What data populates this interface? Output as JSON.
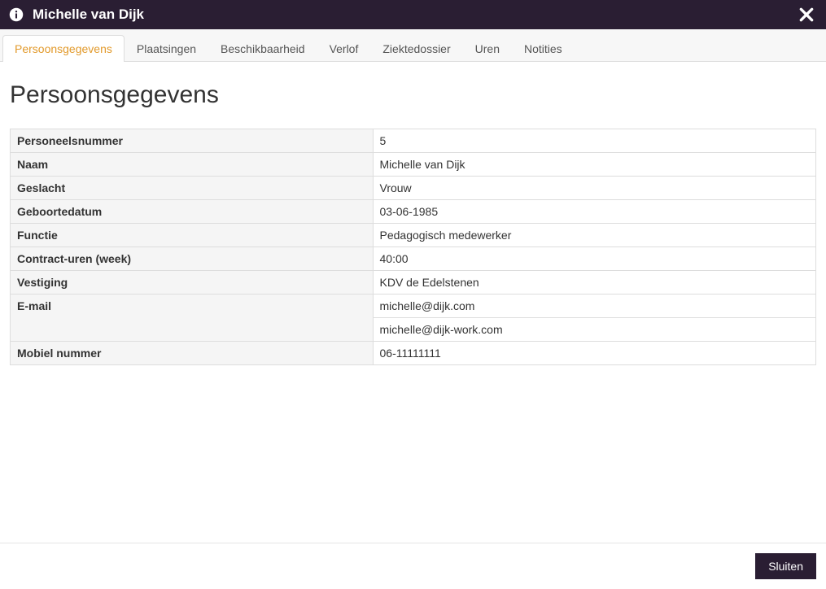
{
  "header": {
    "title": "Michelle van Dijk"
  },
  "tabs": [
    {
      "label": "Persoonsgegevens",
      "active": true
    },
    {
      "label": "Plaatsingen",
      "active": false
    },
    {
      "label": "Beschikbaarheid",
      "active": false
    },
    {
      "label": "Verlof",
      "active": false
    },
    {
      "label": "Ziektedossier",
      "active": false
    },
    {
      "label": "Uren",
      "active": false
    },
    {
      "label": "Notities",
      "active": false
    }
  ],
  "page_title": "Persoonsgegevens",
  "details": [
    {
      "label": "Personeelsnummer",
      "value": "5"
    },
    {
      "label": "Naam",
      "value": "Michelle van Dijk"
    },
    {
      "label": "Geslacht",
      "value": "Vrouw"
    },
    {
      "label": "Geboortedatum",
      "value": "03-06-1985"
    },
    {
      "label": "Functie",
      "value": "Pedagogisch medewerker"
    },
    {
      "label": "Contract-uren (week)",
      "value": "40:00"
    },
    {
      "label": "Vestiging",
      "value": "KDV de Edelstenen"
    },
    {
      "label": "E-mail",
      "value": "michelle@dijk.com"
    },
    {
      "label": "",
      "value": "michelle@dijk-work.com"
    },
    {
      "label": "Mobiel nummer",
      "value": "06-11111111"
    }
  ],
  "footer": {
    "close_label": "Sluiten"
  }
}
